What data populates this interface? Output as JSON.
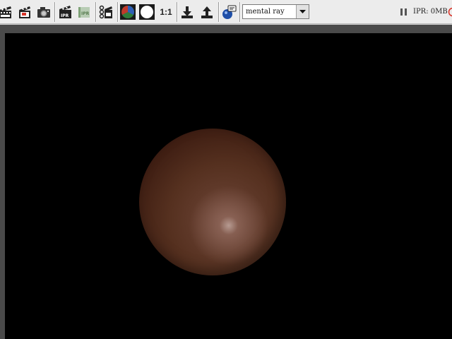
{
  "toolbar": {
    "ratio_label": "1:1",
    "renderer": {
      "selected": "mental ray"
    },
    "icons": [
      "render-clapper-icon",
      "render-region-icon",
      "snapshot-camera-icon",
      "ipr-render-icon",
      "ipr-refresh-icon",
      "render-settings-icon",
      "rgb-channel-icon",
      "alpha-channel-icon",
      "keep-image-icon",
      "remove-image-icon",
      "display-render-info-icon"
    ]
  },
  "status": {
    "ipr_memory": "IPR: 0MB"
  },
  "viewport": {
    "background": "#000000",
    "object": "sphere",
    "object_color": "#5a3426"
  }
}
